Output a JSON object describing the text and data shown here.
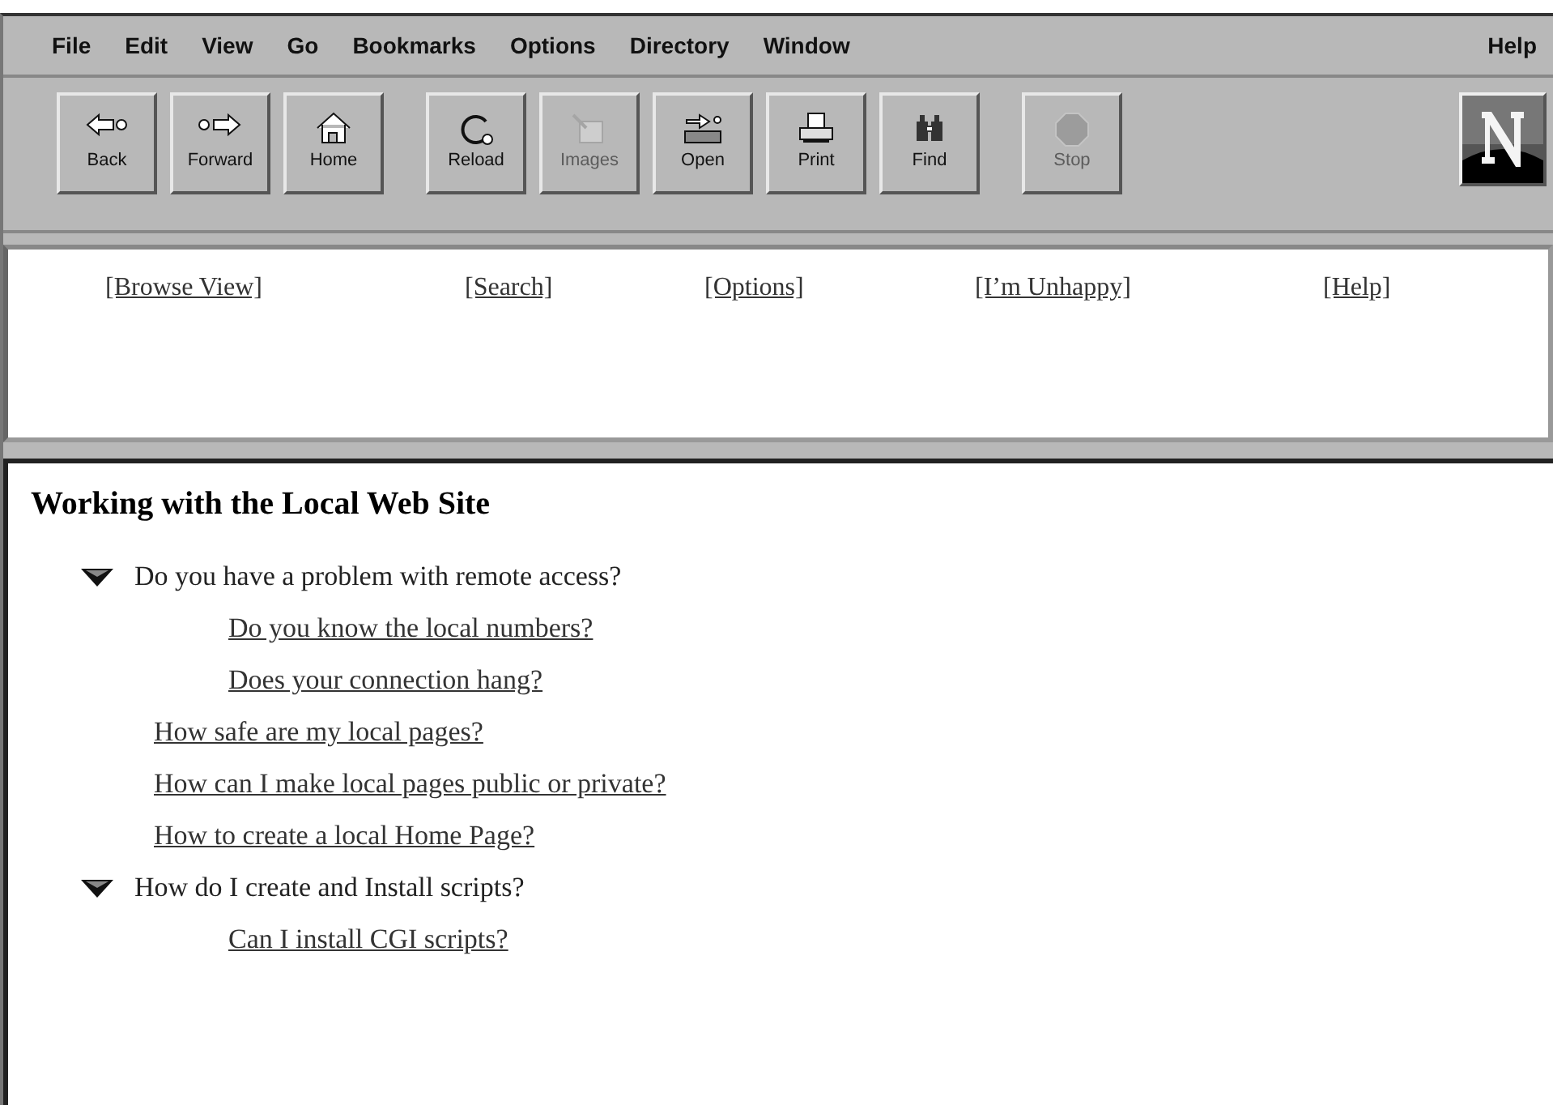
{
  "menu": [
    {
      "label": "File"
    },
    {
      "label": "Edit"
    },
    {
      "label": "View"
    },
    {
      "label": "Go"
    },
    {
      "label": "Bookmarks"
    },
    {
      "label": "Options"
    },
    {
      "label": "Directory"
    },
    {
      "label": "Window"
    },
    {
      "label": "Help"
    }
  ],
  "toolbar": [
    {
      "label": "Back",
      "disabled": false
    },
    {
      "label": "Forward",
      "disabled": false
    },
    {
      "label": "Home",
      "disabled": false
    },
    {
      "label": "Reload",
      "disabled": false
    },
    {
      "label": "Images",
      "disabled": true
    },
    {
      "label": "Open",
      "disabled": false
    },
    {
      "label": "Print",
      "disabled": false
    },
    {
      "label": "Find",
      "disabled": false
    },
    {
      "label": "Stop",
      "disabled": true
    }
  ],
  "nav_links": [
    "[Browse View]",
    "[Search]",
    "[Options]",
    "[I’m Unhappy]",
    "[Help]"
  ],
  "content": {
    "title": "Working with the Local Web Site",
    "items": [
      {
        "kind": "group",
        "text": "Do you have a problem with remote access?",
        "expanded": true,
        "children": [
          {
            "kind": "link",
            "text": "Do you know the local numbers?"
          },
          {
            "kind": "link",
            "text": "Does your connection hang?"
          }
        ]
      },
      {
        "kind": "link",
        "text": "How safe are my local pages?"
      },
      {
        "kind": "link",
        "text": "How can I make local pages public or private?"
      },
      {
        "kind": "link",
        "text": "How to create a local Home Page?"
      },
      {
        "kind": "group",
        "text": "How do I create and Install scripts?",
        "expanded": true,
        "children": [
          {
            "kind": "link",
            "text": "Can I install CGI scripts?"
          }
        ]
      }
    ]
  }
}
